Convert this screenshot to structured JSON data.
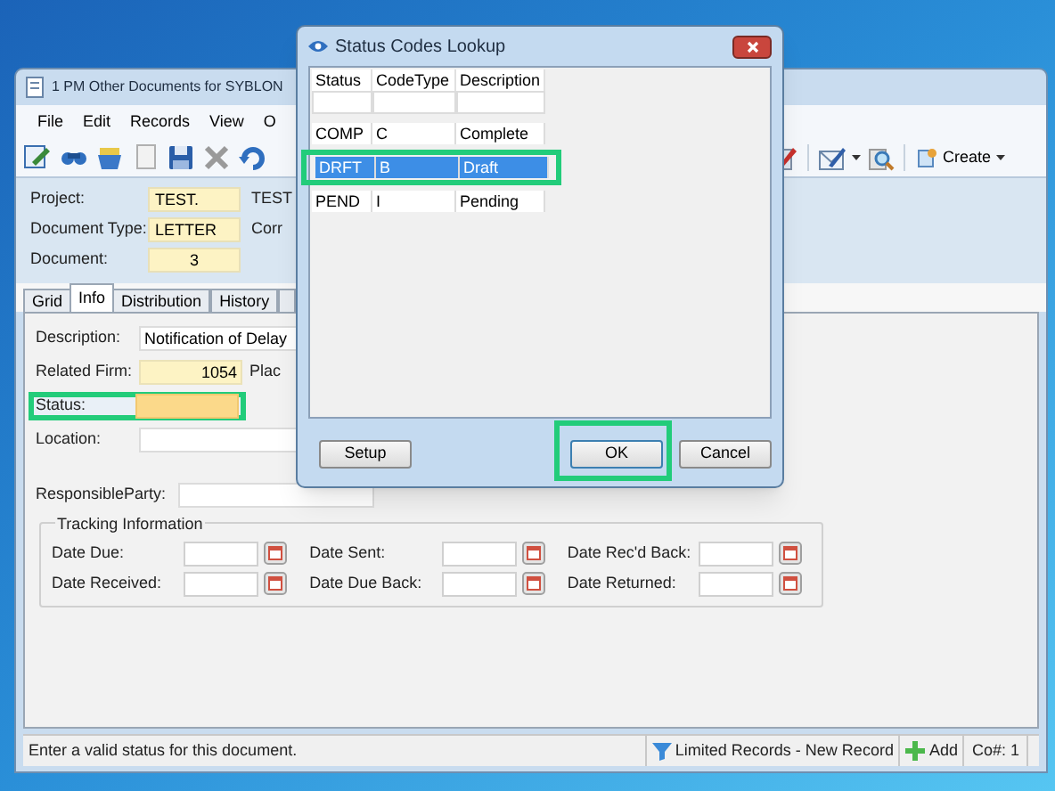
{
  "main_window": {
    "title": "1 PM Other Documents for SYBLON",
    "menu": [
      "File",
      "Edit",
      "Records",
      "View",
      "O"
    ],
    "toolbar": {
      "create_button": "Create"
    },
    "header_fields": [
      {
        "label": "Project:",
        "value": "TEST.",
        "extra": "TEST",
        "kind": "text"
      },
      {
        "label": "Document Type:",
        "value": "LETTER",
        "extra": "Corr",
        "kind": "text"
      },
      {
        "label": "Document:",
        "value": "3",
        "kind": "number"
      }
    ],
    "tabs": [
      {
        "label": "Grid",
        "selected": false
      },
      {
        "label": "Info",
        "selected": true
      },
      {
        "label": "Distribution",
        "selected": false
      },
      {
        "label": "History",
        "selected": false
      }
    ],
    "info_fields": [
      {
        "label": "Description:",
        "value": "Notification of Delay",
        "kind": "text",
        "focused": false,
        "highlighted": false
      },
      {
        "label": "Related Firm:",
        "value": "1054",
        "extra": "Plac",
        "kind": "required",
        "focused": false,
        "highlighted": false
      },
      {
        "label": "Status:",
        "kind": "required",
        "focused": true,
        "highlighted": true
      },
      {
        "label": "Location:",
        "kind": "text",
        "focused": false,
        "highlighted": false
      },
      {
        "label": "ResponsibleParty:",
        "kind": "text",
        "focused": false,
        "highlighted": false
      }
    ],
    "tracking": {
      "title": "Tracking Information",
      "fields": [
        "Date Due:",
        "Date Sent:",
        "Date Rec'd Back:",
        "Date Received:",
        "Date Due Back:",
        "Date Returned:"
      ]
    },
    "status_bar": {
      "message": "Enter a valid status for this document.",
      "filter": "Limited Records - New Record",
      "add": "Add",
      "company": "Co#: 1"
    }
  },
  "dialog": {
    "title": "Status Codes Lookup",
    "columns": [
      "Status",
      "CodeType",
      "Description"
    ],
    "rows": [
      {
        "cells": [
          "COMP",
          "C",
          "Complete"
        ],
        "selected": false,
        "highlighted": false
      },
      {
        "cells": [
          "DRFT",
          "B",
          "Draft"
        ],
        "selected": true,
        "highlighted": true
      },
      {
        "cells": [
          "PEND",
          "I",
          "Pending"
        ],
        "selected": false,
        "highlighted": false
      }
    ],
    "buttons": [
      {
        "label": "Setup",
        "highlighted": false
      },
      {
        "label": "OK",
        "highlighted": true,
        "default": true
      },
      {
        "label": "Cancel",
        "highlighted": false,
        "default": false
      }
    ]
  }
}
